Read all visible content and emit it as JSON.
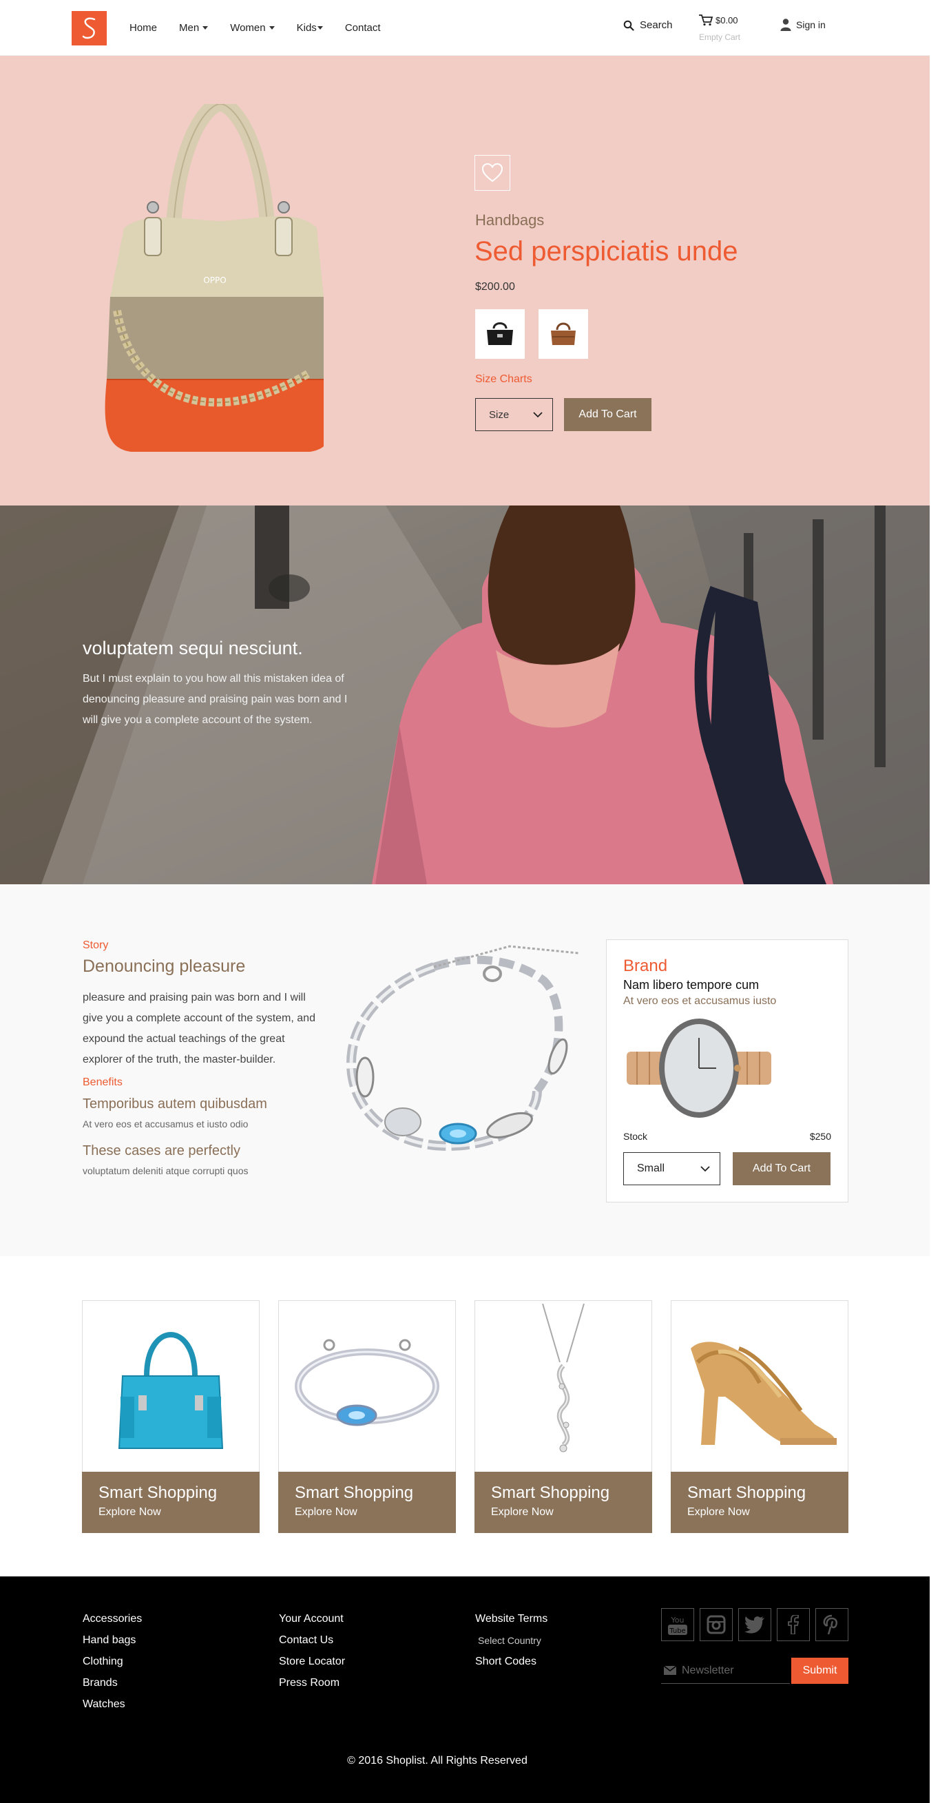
{
  "colors": {
    "accent": "#ee5a31",
    "brown": "#8b735a",
    "hero_bg": "#f2cdc6",
    "footer_bg": "#000000"
  },
  "header": {
    "logo_icon": "s-logo-icon",
    "nav": [
      {
        "label": "Home",
        "dropdown": false
      },
      {
        "label": "Men",
        "dropdown": true
      },
      {
        "label": "Women",
        "dropdown": true
      },
      {
        "label": "Kids",
        "dropdown": true
      },
      {
        "label": "Contact",
        "dropdown": false
      }
    ],
    "search_label": "Search",
    "cart_amount": "$0.00",
    "cart_status": "Empty Cart",
    "signin_label": "Sign in"
  },
  "hero": {
    "category": "Handbags",
    "title": "Sed perspiciatis unde",
    "price": "$200.00",
    "size_charts": "Size Charts",
    "size_select": "Size",
    "add_to_cart": "Add To Cart"
  },
  "banner": {
    "title": "voluptatem sequi nesciunt.",
    "text": "But I must explain to you how all this mistaken idea of denouncing pleasure and praising pain was born and I will give you a complete account of the system."
  },
  "story": {
    "label": "Story",
    "title": "Denouncing pleasure",
    "text": "pleasure and praising pain was born and I will give you a complete account of the system, and expound the actual teachings of the great explorer of the truth, the master-builder.",
    "benefits_label": "Benefits",
    "benefits": [
      {
        "title": "Temporibus autem quibusdam",
        "text": "At vero eos et accusamus et iusto odio"
      },
      {
        "title": "These cases are perfectly",
        "text": "voluptatum deleniti atque corrupti quos"
      }
    ]
  },
  "brand_card": {
    "title": "Brand",
    "subtitle": "Nam libero tempore cum",
    "subtitle2": "At vero eos et accusamus iusto",
    "stock_label": "Stock",
    "price": "$250",
    "size_select": "Small",
    "add_to_cart": "Add To Cart"
  },
  "cards": [
    {
      "image": "blue-handbag",
      "title": "Smart Shopping",
      "link": "Explore Now"
    },
    {
      "image": "silver-bracelet",
      "title": "Smart Shopping",
      "link": "Explore Now"
    },
    {
      "image": "pendant-necklace",
      "title": "Smart Shopping",
      "link": "Explore Now"
    },
    {
      "image": "gold-heels",
      "title": "Smart Shopping",
      "link": "Explore Now"
    }
  ],
  "footer": {
    "col1": [
      "Accessories",
      "Hand bags",
      "Clothing",
      "Brands",
      "Watches"
    ],
    "col2": [
      "Your Account",
      "Contact Us",
      "Store Locator",
      "Press Room"
    ],
    "col3_terms": "Website Terms",
    "col3_country": "Select Country",
    "col3_codes": "Short Codes",
    "social": [
      "youtube-icon",
      "instagram-icon",
      "twitter-icon",
      "facebook-icon",
      "pinterest-icon"
    ],
    "youtube_text": {
      "top": "You",
      "bottom": "Tube"
    },
    "newsletter_placeholder": "Newsletter",
    "submit_label": "Submit",
    "copyright": "© 2016 Shoplist. All Rights Reserved"
  }
}
